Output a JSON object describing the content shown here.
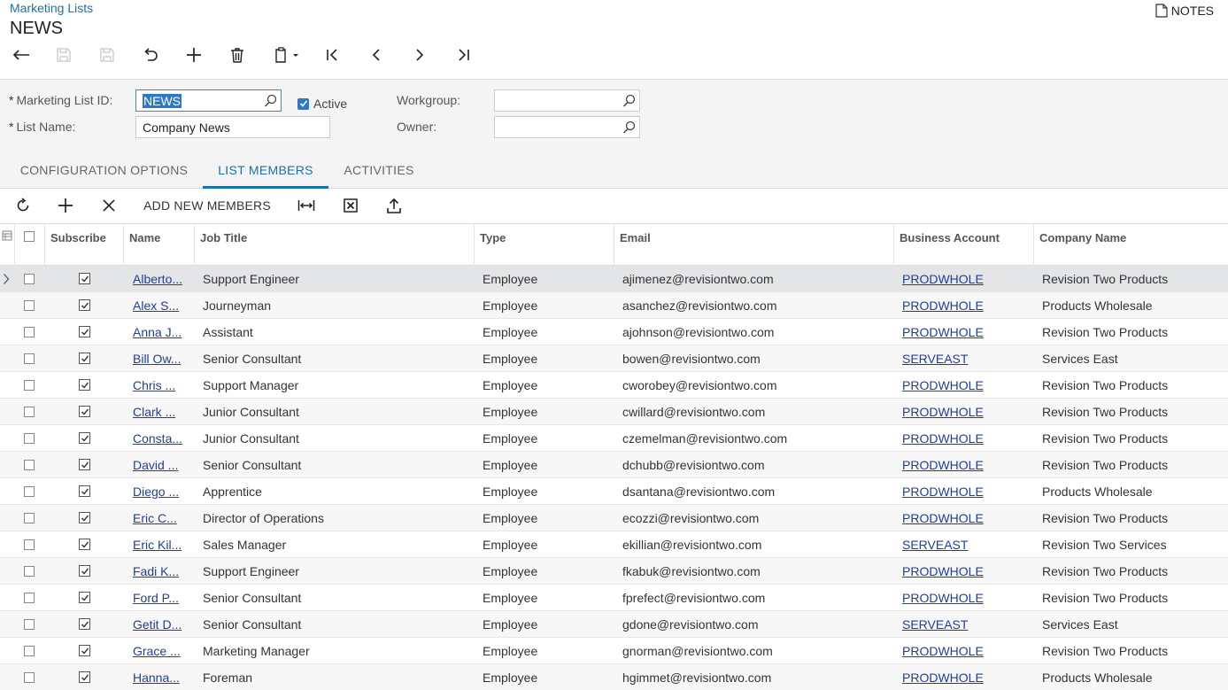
{
  "header": {
    "breadcrumb": "Marketing Lists",
    "title": "NEWS",
    "notes_label": "NOTES"
  },
  "toolbar": {
    "icons": [
      "back-icon",
      "save-close-icon",
      "save-icon",
      "undo-icon",
      "add-icon",
      "delete-icon",
      "copy-paste-icon",
      "first-icon",
      "prev-icon",
      "next-icon",
      "last-icon"
    ]
  },
  "form": {
    "marketing_list_id_label": "Marketing List ID:",
    "marketing_list_id_value": "NEWS",
    "active_label": "Active",
    "list_name_label": "List Name:",
    "list_name_value": "Company News",
    "workgroup_label": "Workgroup:",
    "workgroup_value": "",
    "owner_label": "Owner:",
    "owner_value": "",
    "required_mark": "*"
  },
  "tabs": [
    {
      "label": "CONFIGURATION OPTIONS"
    },
    {
      "label": "LIST MEMBERS"
    },
    {
      "label": "ACTIVITIES"
    }
  ],
  "grid_toolbar": {
    "add_new_members_label": "ADD NEW MEMBERS"
  },
  "grid": {
    "columns": [
      "Subscribe",
      "Name",
      "Job Title",
      "Type",
      "Email",
      "Business Account",
      "Company Name"
    ],
    "rows": [
      {
        "name": "Alberto...",
        "job": "Support Engineer",
        "type": "Employee",
        "email": "ajimenez@revisiontwo.com",
        "account": "PRODWHOLE",
        "company": "Revision Two Products"
      },
      {
        "name": "Alex S...",
        "job": "Journeyman",
        "type": "Employee",
        "email": "asanchez@revisiontwo.com",
        "account": "PRODWHOLE",
        "company": "Products Wholesale"
      },
      {
        "name": "Anna J...",
        "job": "Assistant",
        "type": "Employee",
        "email": "ajohnson@revisiontwo.com",
        "account": "PRODWHOLE",
        "company": "Revision Two Products"
      },
      {
        "name": "Bill Ow...",
        "job": "Senior Consultant",
        "type": "Employee",
        "email": "bowen@revisiontwo.com",
        "account": "SERVEAST",
        "company": "Services East"
      },
      {
        "name": "Chris ...",
        "job": "Support Manager",
        "type": "Employee",
        "email": "cworobey@revisiontwo.com",
        "account": "PRODWHOLE",
        "company": "Revision Two Products"
      },
      {
        "name": "Clark ...",
        "job": "Junior Consultant",
        "type": "Employee",
        "email": "cwillard@revisiontwo.com",
        "account": "PRODWHOLE",
        "company": "Revision Two Products"
      },
      {
        "name": "Consta...",
        "job": "Junior Consultant",
        "type": "Employee",
        "email": "czemelman@revisiontwo.com",
        "account": "PRODWHOLE",
        "company": "Revision Two Products"
      },
      {
        "name": "David ...",
        "job": "Senior Consultant",
        "type": "Employee",
        "email": "dchubb@revisiontwo.com",
        "account": "PRODWHOLE",
        "company": "Revision Two Products"
      },
      {
        "name": "Diego ...",
        "job": "Apprentice",
        "type": "Employee",
        "email": "dsantana@revisiontwo.com",
        "account": "PRODWHOLE",
        "company": "Products Wholesale"
      },
      {
        "name": "Eric C...",
        "job": "Director of Operations",
        "type": "Employee",
        "email": "ecozzi@revisiontwo.com",
        "account": "PRODWHOLE",
        "company": "Revision Two Products"
      },
      {
        "name": "Eric Kil...",
        "job": "Sales Manager",
        "type": "Employee",
        "email": "ekillian@revisiontwo.com",
        "account": "SERVEAST",
        "company": "Revision Two Services"
      },
      {
        "name": "Fadi K...",
        "job": "Support Engineer",
        "type": "Employee",
        "email": "fkabuk@revisiontwo.com",
        "account": "PRODWHOLE",
        "company": "Revision Two Products"
      },
      {
        "name": "Ford P...",
        "job": "Senior Consultant",
        "type": "Employee",
        "email": "fprefect@revisiontwo.com",
        "account": "PRODWHOLE",
        "company": "Revision Two Products"
      },
      {
        "name": "Getit D...",
        "job": "Senior Consultant",
        "type": "Employee",
        "email": "gdone@revisiontwo.com",
        "account": "SERVEAST",
        "company": "Services East"
      },
      {
        "name": "Grace ...",
        "job": "Marketing Manager",
        "type": "Employee",
        "email": "gnorman@revisiontwo.com",
        "account": "PRODWHOLE",
        "company": "Revision Two Products"
      },
      {
        "name": "Hanna...",
        "job": "Foreman",
        "type": "Employee",
        "email": "hgimmet@revisiontwo.com",
        "account": "PRODWHOLE",
        "company": "Products Wholesale"
      }
    ]
  },
  "colors": {
    "accent": "#1f6fa8",
    "link": "#1f3e9e",
    "selection": "#2d78c8"
  }
}
